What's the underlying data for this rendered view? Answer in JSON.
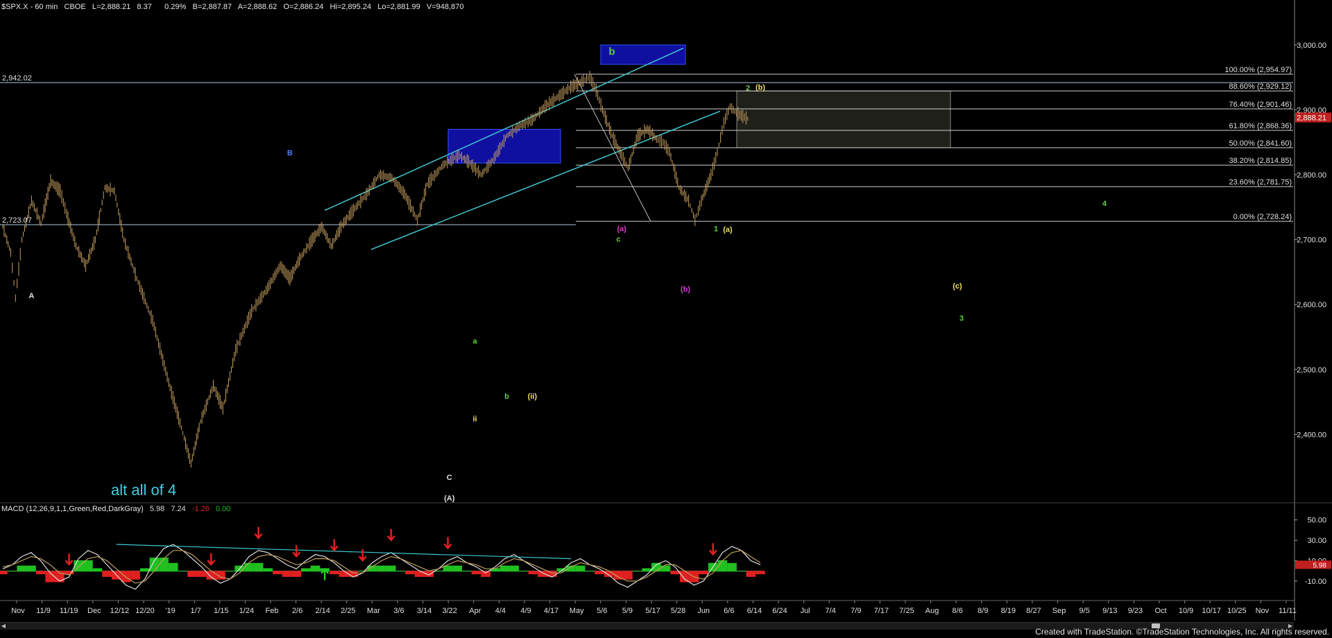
{
  "header": {
    "symbol": "$SPX.X - 60 min",
    "exchange": "CBOE",
    "last": "L=2,888.21",
    "change": "8.37",
    "change_pct": "0.29%",
    "bid": "B=2,887.87",
    "ask": "A=2,888.62",
    "open": "O=2,886.24",
    "high": "Hi=2,895.24",
    "low": "Lo=2,881.99",
    "volume": "V=948,870"
  },
  "macd_header": {
    "label": "MACD (12,26,9,1,1,Green,Red,DarkGray)",
    "v1": "5.98",
    "v2": "7.24",
    "v3": "-1.26",
    "v4": "0.00"
  },
  "footer": {
    "text": "Created with TradeStation. ©TradeStation Technologies, Inc. All rights reserved."
  },
  "colors": {
    "background": "#000000",
    "price_bar": "#c8a060",
    "cyan": "#40c8d0",
    "macd_line": "#e0e0e0",
    "signal_line": "#c0a060",
    "hist_pos": "#20c020",
    "hist_neg": "#e02020",
    "arrow_red": "#e02020",
    "arrow_green": "#20d020",
    "label_green": "#60d040",
    "label_yellow": "#f0e060",
    "label_white": "#e0e0e0",
    "label_magenta": "#d040d0",
    "label_blue": "#5080ff",
    "alt_text": "#40d0e0",
    "box_blue": "#1010a0",
    "fib_box": "#3a3a30",
    "last_price_box": "#c02020"
  },
  "chart_data": [
    {
      "type": "line",
      "title": "$SPX.X - 60 min",
      "x_dates": [
        "Nov",
        "11/9",
        "11/19",
        "Dec",
        "12/12",
        "12/20",
        "'19",
        "1/7",
        "1/15",
        "1/24",
        "Feb",
        "2/6",
        "2/14",
        "2/25",
        "Mar",
        "3/6",
        "3/14",
        "3/22",
        "Apr",
        "4/4",
        "4/9",
        "4/17",
        "May",
        "5/6",
        "5/9",
        "5/17",
        "5/28",
        "Jun",
        "6/6",
        "6/14",
        "6/24",
        "Jul",
        "7/4",
        "7/9",
        "7/17",
        "7/25",
        "Aug",
        "8/6",
        "8/9",
        "8/19",
        "8/27",
        "Sep",
        "9/5",
        "9/13",
        "9/23",
        "Oct",
        "10/9",
        "10/17",
        "10/25",
        "Nov",
        "11/11"
      ],
      "ylim": [
        2300,
        3050
      ],
      "y_ticks": [
        "3,000.00",
        "2,900.00",
        "2,800.00",
        "2,700.00",
        "2,600.00",
        "2,500.00",
        "2,400.00"
      ],
      "y_tick_values": [
        3000,
        2900,
        2800,
        2700,
        2600,
        2500,
        2400
      ],
      "last_price": "2,888.21",
      "price_path": [
        [
          0,
          2720
        ],
        [
          5,
          2680
        ],
        [
          8,
          2610
        ],
        [
          12,
          2700
        ],
        [
          18,
          2760
        ],
        [
          24,
          2725
        ],
        [
          30,
          2790
        ],
        [
          36,
          2775
        ],
        [
          40,
          2740
        ],
        [
          46,
          2690
        ],
        [
          52,
          2660
        ],
        [
          58,
          2700
        ],
        [
          64,
          2780
        ],
        [
          70,
          2775
        ],
        [
          76,
          2700
        ],
        [
          84,
          2640
        ],
        [
          94,
          2575
        ],
        [
          104,
          2480
        ],
        [
          112,
          2410
        ],
        [
          118,
          2355
        ],
        [
          124,
          2420
        ],
        [
          132,
          2475
        ],
        [
          138,
          2440
        ],
        [
          146,
          2530
        ],
        [
          156,
          2590
        ],
        [
          166,
          2625
        ],
        [
          174,
          2660
        ],
        [
          180,
          2640
        ],
        [
          186,
          2670
        ],
        [
          194,
          2700
        ],
        [
          200,
          2720
        ],
        [
          206,
          2690
        ],
        [
          212,
          2720
        ],
        [
          218,
          2740
        ],
        [
          228,
          2770
        ],
        [
          236,
          2800
        ],
        [
          244,
          2795
        ],
        [
          252,
          2770
        ],
        [
          260,
          2730
        ],
        [
          266,
          2785
        ],
        [
          276,
          2815
        ],
        [
          286,
          2830
        ],
        [
          292,
          2820
        ],
        [
          300,
          2800
        ],
        [
          308,
          2825
        ],
        [
          316,
          2860
        ],
        [
          324,
          2875
        ],
        [
          332,
          2885
        ],
        [
          340,
          2905
        ],
        [
          348,
          2920
        ],
        [
          356,
          2935
        ],
        [
          364,
          2945
        ],
        [
          368,
          2950
        ],
        [
          372,
          2930
        ],
        [
          376,
          2900
        ],
        [
          382,
          2860
        ],
        [
          388,
          2830
        ],
        [
          392,
          2810
        ],
        [
          398,
          2860
        ],
        [
          404,
          2870
        ],
        [
          410,
          2855
        ],
        [
          414,
          2850
        ],
        [
          418,
          2835
        ],
        [
          424,
          2780
        ],
        [
          430,
          2760
        ],
        [
          434,
          2730
        ],
        [
          438,
          2760
        ],
        [
          444,
          2800
        ],
        [
          448,
          2835
        ],
        [
          452,
          2880
        ],
        [
          456,
          2905
        ],
        [
          460,
          2895
        ],
        [
          464,
          2890
        ],
        [
          468,
          2885
        ]
      ],
      "price_path_units": "x = 0-468 index along session timeline, y = price",
      "hlines": [
        {
          "label": "2,942.02",
          "value": 2942.02
        },
        {
          "label": "2,723.07",
          "value": 2723.07
        }
      ],
      "fib_levels": [
        {
          "label": "100.00% (2,954.97)",
          "value": 2954.97
        },
        {
          "label": "88.60% (2,929.12)",
          "value": 2929.12
        },
        {
          "label": "76.40% (2,901.46)",
          "value": 2901.46
        },
        {
          "label": "61.80% (2,868.36)",
          "value": 2868.36
        },
        {
          "label": "50.00% (2,841.60)",
          "value": 2841.6
        },
        {
          "label": "38.20% (2,814.85)",
          "value": 2814.85
        },
        {
          "label": "23.60% (2,781.75)",
          "value": 2781.75
        },
        {
          "label": "0.00% (2,728.24)",
          "value": 2728.24
        }
      ],
      "wave_labels": [
        {
          "text": "A",
          "color": "white",
          "x": 18,
          "y": 2610
        },
        {
          "text": "B",
          "color": "blue",
          "x": 180,
          "y": 2830
        },
        {
          "text": "C",
          "color": "white",
          "x": 280,
          "y": 2330
        },
        {
          "text": "(A)",
          "color": "white",
          "x": 280,
          "y": 2298
        },
        {
          "text": "a",
          "color": "green",
          "x": 296,
          "y": 2540
        },
        {
          "text": "ii",
          "color": "yellow",
          "x": 296,
          "y": 2420
        },
        {
          "text": "b",
          "color": "green",
          "x": 316,
          "y": 2455
        },
        {
          "text": "(ii)",
          "color": "yellow",
          "x": 332,
          "y": 2455
        },
        {
          "text": "(a)",
          "color": "magenta",
          "x": 388,
          "y": 2713
        },
        {
          "text": "c",
          "color": "green",
          "x": 386,
          "y": 2697
        },
        {
          "text": "(b)",
          "color": "magenta",
          "x": 428,
          "y": 2620
        },
        {
          "text": "b",
          "color": "green",
          "x": 882,
          "y": 2985
        },
        {
          "text": "2",
          "color": "green",
          "x": 1078,
          "y": 2930
        },
        {
          "text": "(b)",
          "color": "yellow",
          "x": 1096,
          "y": 2931
        },
        {
          "text": "1",
          "color": "green",
          "x": 1032,
          "y": 2713
        },
        {
          "text": "(a)",
          "color": "yellow",
          "x": 1049,
          "y": 2712
        },
        {
          "text": "4",
          "color": "green",
          "x": 1592,
          "y": 2752
        },
        {
          "text": "(c)",
          "color": "yellow",
          "x": 1380,
          "y": 2625
        },
        {
          "text": "3",
          "color": "green",
          "x": 1386,
          "y": 2575
        }
      ],
      "annotation": "alt all of 4"
    },
    {
      "type": "line",
      "title": "MACD (12,26,9,1,1,Green,Red,DarkGray)",
      "ylim": [
        -25,
        60
      ],
      "y_ticks": [
        "50.00",
        "30.00",
        "10.00",
        "-10.00"
      ],
      "y_tick_values": [
        50,
        30,
        10,
        -10
      ],
      "values": {
        "macd": "5.98",
        "signal": "7.24",
        "hist": "-1.26",
        "zero": "0.00"
      },
      "macd_series": [
        2,
        6,
        14,
        18,
        10,
        -2,
        -10,
        -6,
        12,
        20,
        16,
        6,
        -4,
        -14,
        -18,
        -8,
        10,
        22,
        26,
        20,
        12,
        4,
        -6,
        -12,
        -8,
        2,
        14,
        20,
        18,
        12,
        6,
        2,
        10,
        16,
        14,
        8,
        0,
        -6,
        -2,
        8,
        14,
        18,
        12,
        6,
        0,
        -4,
        2,
        10,
        14,
        8,
        4,
        -2,
        4,
        12,
        16,
        10,
        4,
        -2,
        -6,
        0,
        8,
        12,
        6,
        2,
        -4,
        -12,
        -16,
        -10,
        -4,
        6,
        10,
        4,
        -8,
        -14,
        -10,
        4,
        18,
        24,
        20,
        10,
        6
      ],
      "signal_series": [
        4,
        6,
        10,
        14,
        12,
        6,
        -2,
        -4,
        4,
        12,
        14,
        10,
        2,
        -6,
        -12,
        -10,
        0,
        12,
        20,
        20,
        16,
        8,
        0,
        -6,
        -8,
        -2,
        8,
        14,
        16,
        14,
        10,
        6,
        8,
        12,
        12,
        10,
        4,
        -2,
        -2,
        4,
        10,
        14,
        12,
        8,
        4,
        0,
        2,
        6,
        10,
        8,
        6,
        2,
        2,
        8,
        12,
        10,
        6,
        2,
        -2,
        -2,
        4,
        8,
        6,
        4,
        0,
        -6,
        -10,
        -10,
        -6,
        0,
        6,
        6,
        0,
        -6,
        -8,
        -2,
        10,
        18,
        20,
        14,
        8
      ],
      "sell_arrow_idx": [
        7,
        22,
        27,
        31,
        35,
        38,
        41,
        47,
        75
      ],
      "buy_arrow_idx": [
        34
      ]
    }
  ]
}
